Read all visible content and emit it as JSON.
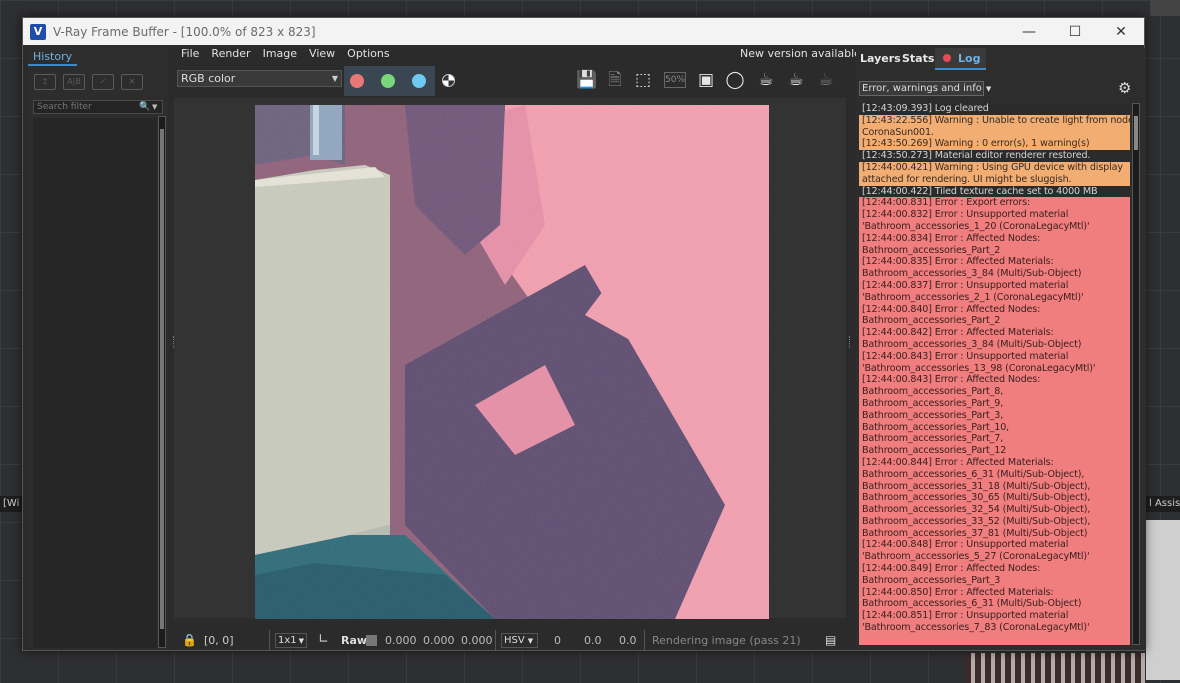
{
  "window": {
    "title": "V-Ray Frame Buffer - [100.0% of 823 x 823]",
    "app_icon": "V"
  },
  "background": {
    "left_label": "[Wi",
    "right_label": "l Assis"
  },
  "history": {
    "tab": "History",
    "search_placeholder": "Search filter",
    "tools": [
      "load-icon",
      "compare-icon",
      "save-icon",
      "remove-icon"
    ]
  },
  "menu": {
    "items": [
      "File",
      "Render",
      "Image",
      "View",
      "Options"
    ],
    "new_version": "New version available!"
  },
  "toolbar": {
    "channel": "RGB color",
    "zoom_badge": "50%",
    "icons": [
      "save-image-icon",
      "save-all-icon",
      "region-render-icon",
      "follow-mouse-icon",
      "track-mouse-icon",
      "lens-effects-icon",
      "interactive-render-icon",
      "stop-render-icon",
      "teapot-render-icon"
    ],
    "channel_colors": {
      "red": "#e87878",
      "green": "#7ad67a",
      "blue": "#6fc8f0"
    }
  },
  "status": {
    "coords": "[0, 0]",
    "sample": "1x1",
    "raw": "Raw",
    "rgb": [
      "0.000",
      "0.000",
      "0.000"
    ],
    "color_mode": "HSV",
    "hsv": [
      "0",
      "0.0",
      "0.0"
    ],
    "message": "Rendering image (pass 21)"
  },
  "right_panel": {
    "tabs": {
      "layers": "Layers",
      "stats": "Stats",
      "log": "Log"
    },
    "filter": "Error, warnings and info"
  },
  "log": [
    {
      "level": "info",
      "text": "[12:43:09.393] Log cleared"
    },
    {
      "level": "warning",
      "text": "[12:43:22.556] Warning : Unable to create light from node"
    },
    {
      "level": "warning",
      "text": "CoronaSun001."
    },
    {
      "level": "warning",
      "text": "[12:43:50.269] Warning : 0 error(s), 1 warning(s)"
    },
    {
      "level": "info",
      "text": "[12:43:50.273] Material editor renderer restored."
    },
    {
      "level": "warning",
      "text": "[12:44:00.421] Warning : Using GPU device with display"
    },
    {
      "level": "warning",
      "text": "attached for rendering. UI might be sluggish."
    },
    {
      "level": "info",
      "text": "[12:44:00.422] Tiled texture cache set to 4000 MB"
    },
    {
      "level": "error",
      "text": "[12:44:00.831] Error : Export errors:"
    },
    {
      "level": "error",
      "text": "[12:44:00.832] Error : Unsupported material"
    },
    {
      "level": "error",
      "text": "'Bathroom_accessories_1_20 (CoronaLegacyMtl)'"
    },
    {
      "level": "error",
      "text": "[12:44:00.834] Error : Affected Nodes:"
    },
    {
      "level": "error",
      "text": "Bathroom_accessories_Part_2"
    },
    {
      "level": "error",
      "text": "[12:44:00.835] Error : Affected Materials:"
    },
    {
      "level": "error",
      "text": "Bathroom_accessories_3_84 (Multi/Sub-Object)"
    },
    {
      "level": "error",
      "text": "[12:44:00.837] Error : Unsupported material"
    },
    {
      "level": "error",
      "text": "'Bathroom_accessories_2_1 (CoronaLegacyMtl)'"
    },
    {
      "level": "error",
      "text": "[12:44:00.840] Error : Affected Nodes:"
    },
    {
      "level": "error",
      "text": "Bathroom_accessories_Part_2"
    },
    {
      "level": "error",
      "text": "[12:44:00.842] Error : Affected Materials:"
    },
    {
      "level": "error",
      "text": "Bathroom_accessories_3_84 (Multi/Sub-Object)"
    },
    {
      "level": "error",
      "text": "[12:44:00.843] Error : Unsupported material"
    },
    {
      "level": "error",
      "text": "'Bathroom_accessories_13_98 (CoronaLegacyMtl)'"
    },
    {
      "level": "error",
      "text": "[12:44:00.843] Error : Affected Nodes:"
    },
    {
      "level": "error",
      "text": "Bathroom_accessories_Part_8,"
    },
    {
      "level": "error",
      "text": "Bathroom_accessories_Part_9,"
    },
    {
      "level": "error",
      "text": "Bathroom_accessories_Part_3,"
    },
    {
      "level": "error",
      "text": "Bathroom_accessories_Part_10,"
    },
    {
      "level": "error",
      "text": "Bathroom_accessories_Part_7,"
    },
    {
      "level": "error",
      "text": "Bathroom_accessories_Part_12"
    },
    {
      "level": "error",
      "text": "[12:44:00.844] Error : Affected Materials:"
    },
    {
      "level": "error",
      "text": "Bathroom_accessories_6_31 (Multi/Sub-Object),"
    },
    {
      "level": "error",
      "text": "Bathroom_accessories_31_18 (Multi/Sub-Object),"
    },
    {
      "level": "error",
      "text": "Bathroom_accessories_30_65 (Multi/Sub-Object),"
    },
    {
      "level": "error",
      "text": "Bathroom_accessories_32_54 (Multi/Sub-Object),"
    },
    {
      "level": "error",
      "text": "Bathroom_accessories_33_52 (Multi/Sub-Object),"
    },
    {
      "level": "error",
      "text": "Bathroom_accessories_37_81 (Multi/Sub-Object)"
    },
    {
      "level": "error",
      "text": "[12:44:00.848] Error : Unsupported material"
    },
    {
      "level": "error",
      "text": "'Bathroom_accessories_5_27 (CoronaLegacyMtl)'"
    },
    {
      "level": "error",
      "text": "[12:44:00.849] Error : Affected Nodes:"
    },
    {
      "level": "error",
      "text": "Bathroom_accessories_Part_3"
    },
    {
      "level": "error",
      "text": "[12:44:00.850] Error : Affected Materials:"
    },
    {
      "level": "error",
      "text": "Bathroom_accessories_6_31 (Multi/Sub-Object)"
    },
    {
      "level": "error",
      "text": "[12:44:00.851] Error : Unsupported material"
    },
    {
      "level": "error",
      "text": "'Bathroom_accessories_7_83 (CoronaLegacyMtl)'"
    },
    {
      "level": "error",
      "text": ""
    }
  ],
  "colors": {
    "accent": "#3b89c9",
    "error_bg": "#f07e7e",
    "warning_bg": "#f1ad72",
    "wall_pink": "#f2a0b0",
    "shadow_purple": "#5c4a6e"
  }
}
